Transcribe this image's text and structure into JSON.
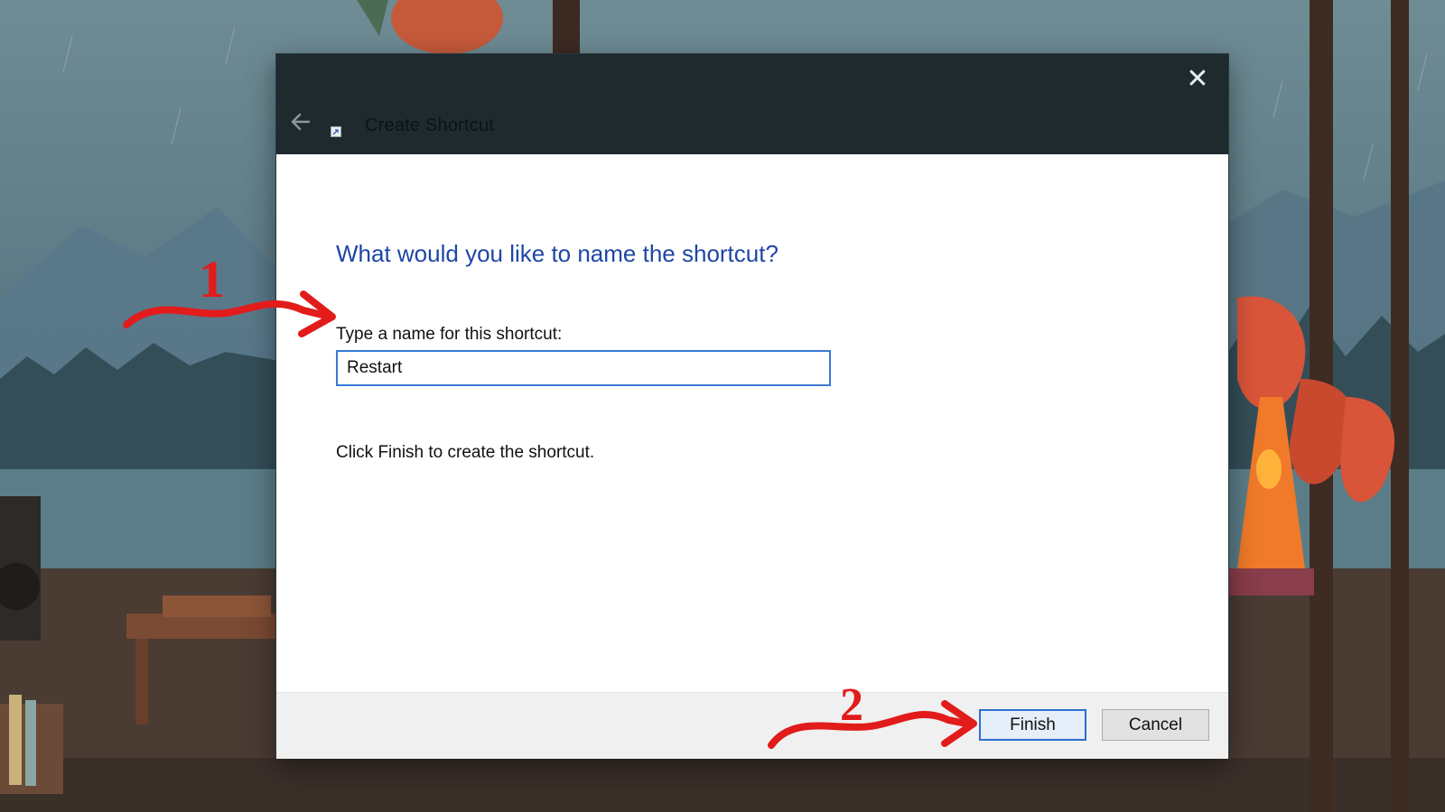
{
  "window": {
    "title": "Create Shortcut",
    "close_glyph": "✕"
  },
  "wizard": {
    "heading": "What would you like to name the shortcut?",
    "name_label": "Type a name for this shortcut:",
    "name_value": "Restart",
    "instruction": "Click Finish to create the shortcut."
  },
  "buttons": {
    "finish": "Finish",
    "cancel": "Cancel"
  },
  "annotations": {
    "step1": "1",
    "step2": "2"
  },
  "icons": {
    "back": "arrow-left-icon",
    "close": "close-icon",
    "wizard": "shortcut-icon"
  },
  "colors": {
    "titlebar": "#1f2a2f",
    "heading": "#1e46a6",
    "input_border": "#3a7ad6",
    "annotation": "#e21b1b"
  }
}
